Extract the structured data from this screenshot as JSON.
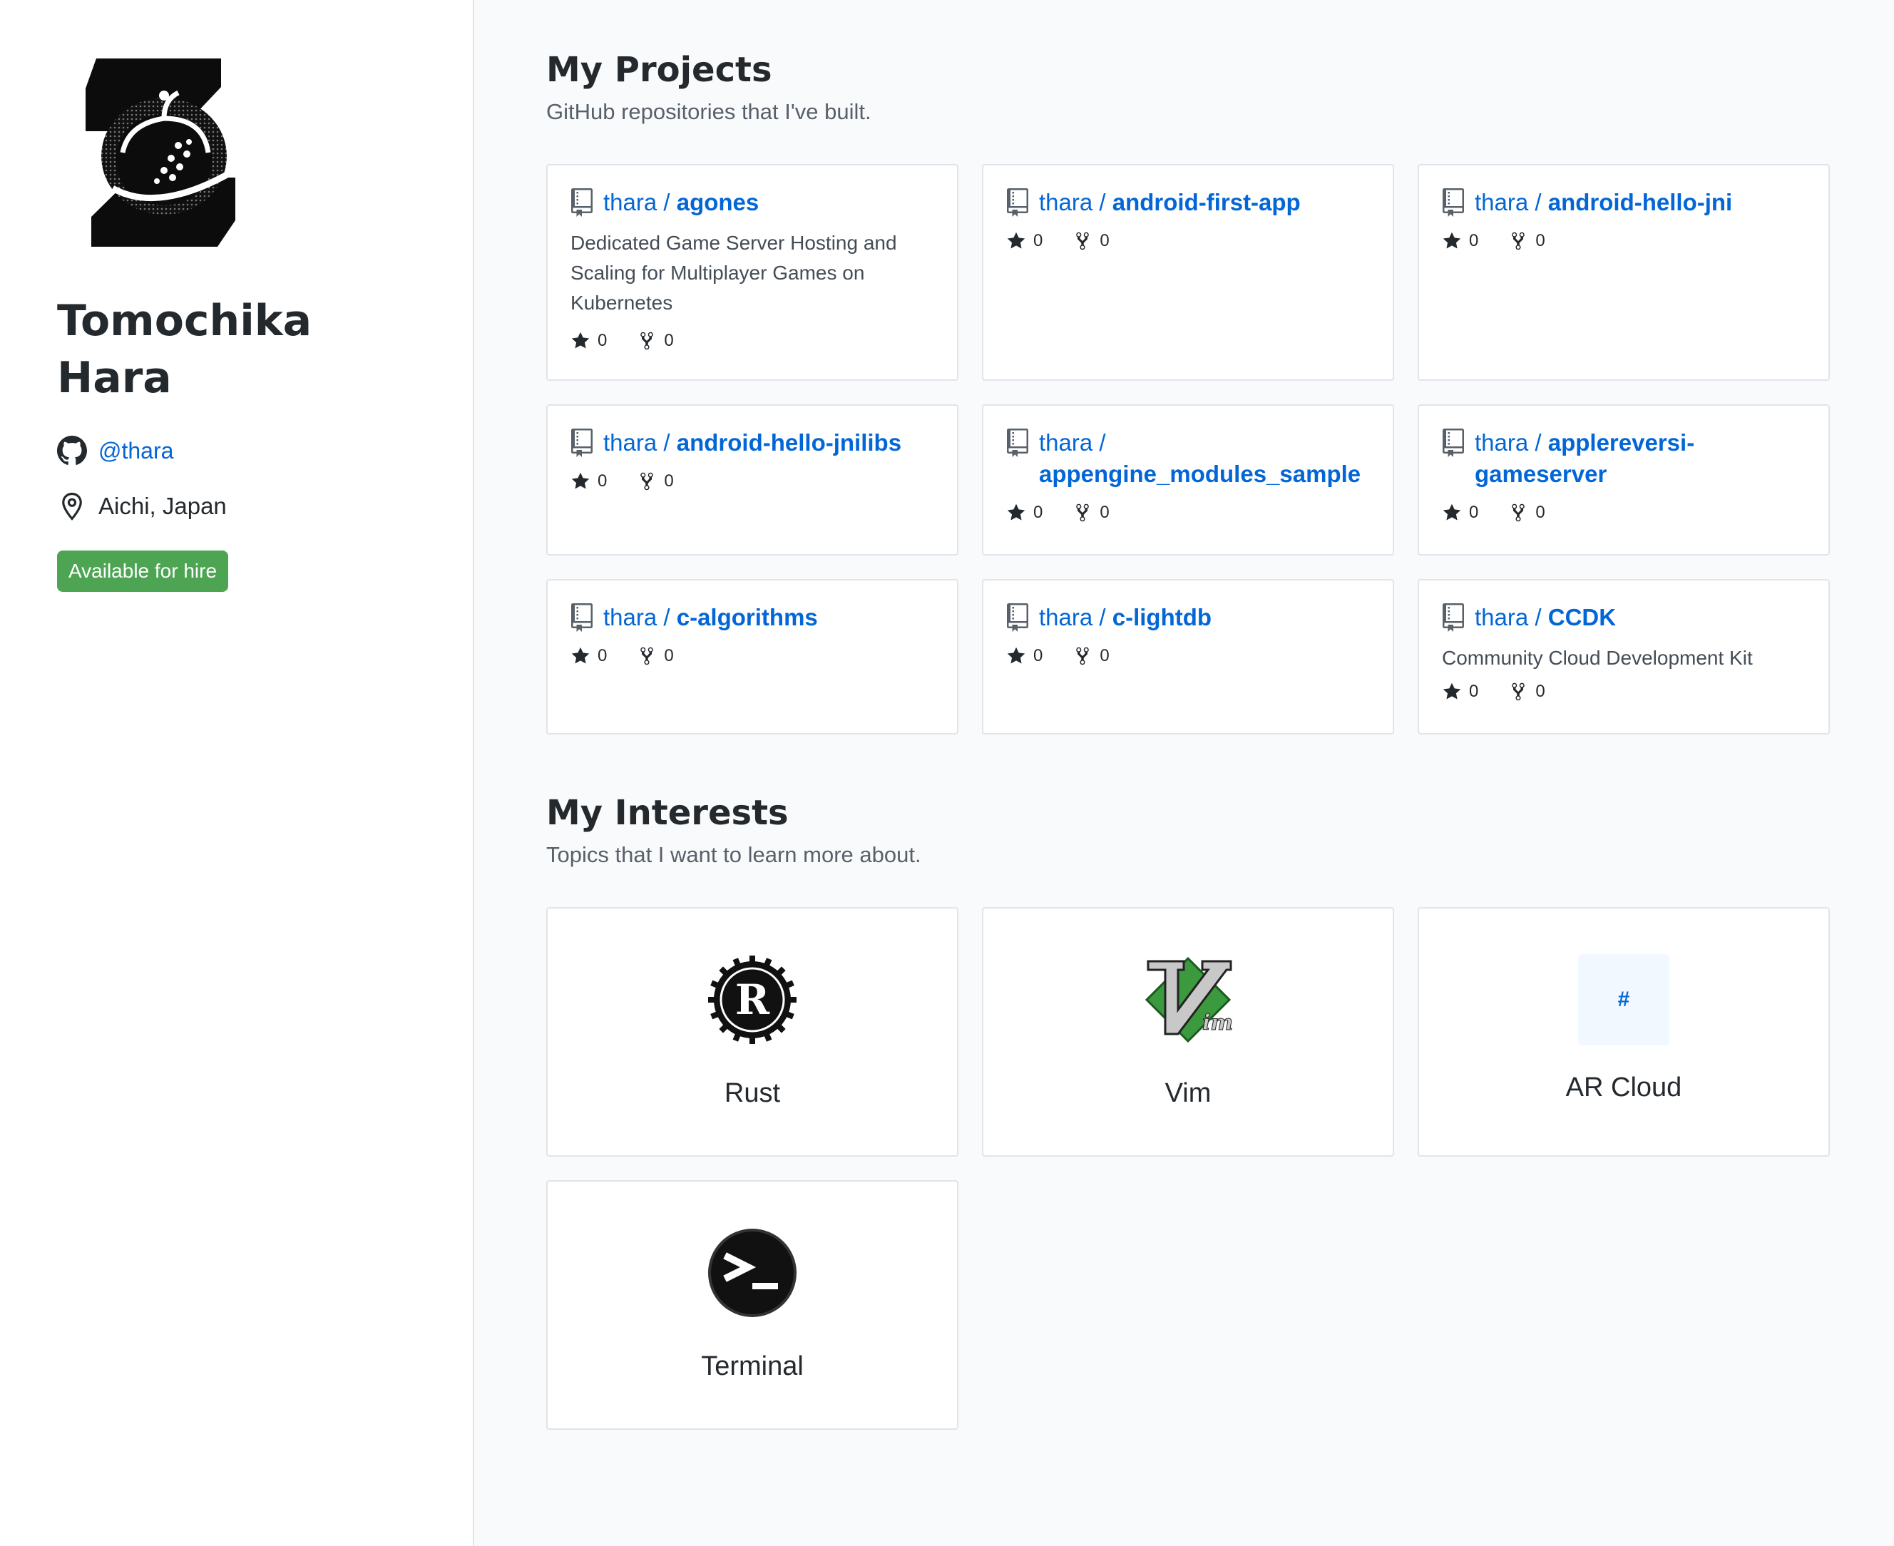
{
  "profile": {
    "name": "Tomochika Hara",
    "github_handle": "@thara",
    "location": "Aichi, Japan",
    "hire_badge": "Available for hire",
    "accent_color": "#0366d6",
    "hire_color": "#4da553"
  },
  "projects": {
    "title": "My Projects",
    "subtitle": "GitHub repositories that I've built.",
    "items": [
      {
        "owner": "thara",
        "repo": "agones",
        "description": "Dedicated Game Server Hosting and Scaling for Multiplayer Games on Kubernetes",
        "stars": "0",
        "forks": "0"
      },
      {
        "owner": "thara",
        "repo": "android-first-app",
        "description": "",
        "stars": "0",
        "forks": "0"
      },
      {
        "owner": "thara",
        "repo": "android-hello-jni",
        "description": "",
        "stars": "0",
        "forks": "0"
      },
      {
        "owner": "thara",
        "repo": "android-hello-jnilibs",
        "description": "",
        "stars": "0",
        "forks": "0"
      },
      {
        "owner": "thara",
        "repo": "appengine_modules_sample",
        "description": "",
        "stars": "0",
        "forks": "0"
      },
      {
        "owner": "thara",
        "repo": "applereversi-gameserver",
        "description": "",
        "stars": "0",
        "forks": "0"
      },
      {
        "owner": "thara",
        "repo": "c-algorithms",
        "description": "",
        "stars": "0",
        "forks": "0"
      },
      {
        "owner": "thara",
        "repo": "c-lightdb",
        "description": "",
        "stars": "0",
        "forks": "0"
      },
      {
        "owner": "thara",
        "repo": "CCDK",
        "description": "Community Cloud Development Kit",
        "stars": "0",
        "forks": "0"
      }
    ]
  },
  "interests": {
    "title": "My Interests",
    "subtitle": "Topics that I want to learn more about.",
    "items": [
      {
        "label": "Rust",
        "icon": "rust-logo-icon"
      },
      {
        "label": "Vim",
        "icon": "vim-logo-icon"
      },
      {
        "label": "AR Cloud",
        "icon": "hash-placeholder",
        "placeholder": "#"
      },
      {
        "label": "Terminal",
        "icon": "terminal-icon"
      }
    ]
  }
}
